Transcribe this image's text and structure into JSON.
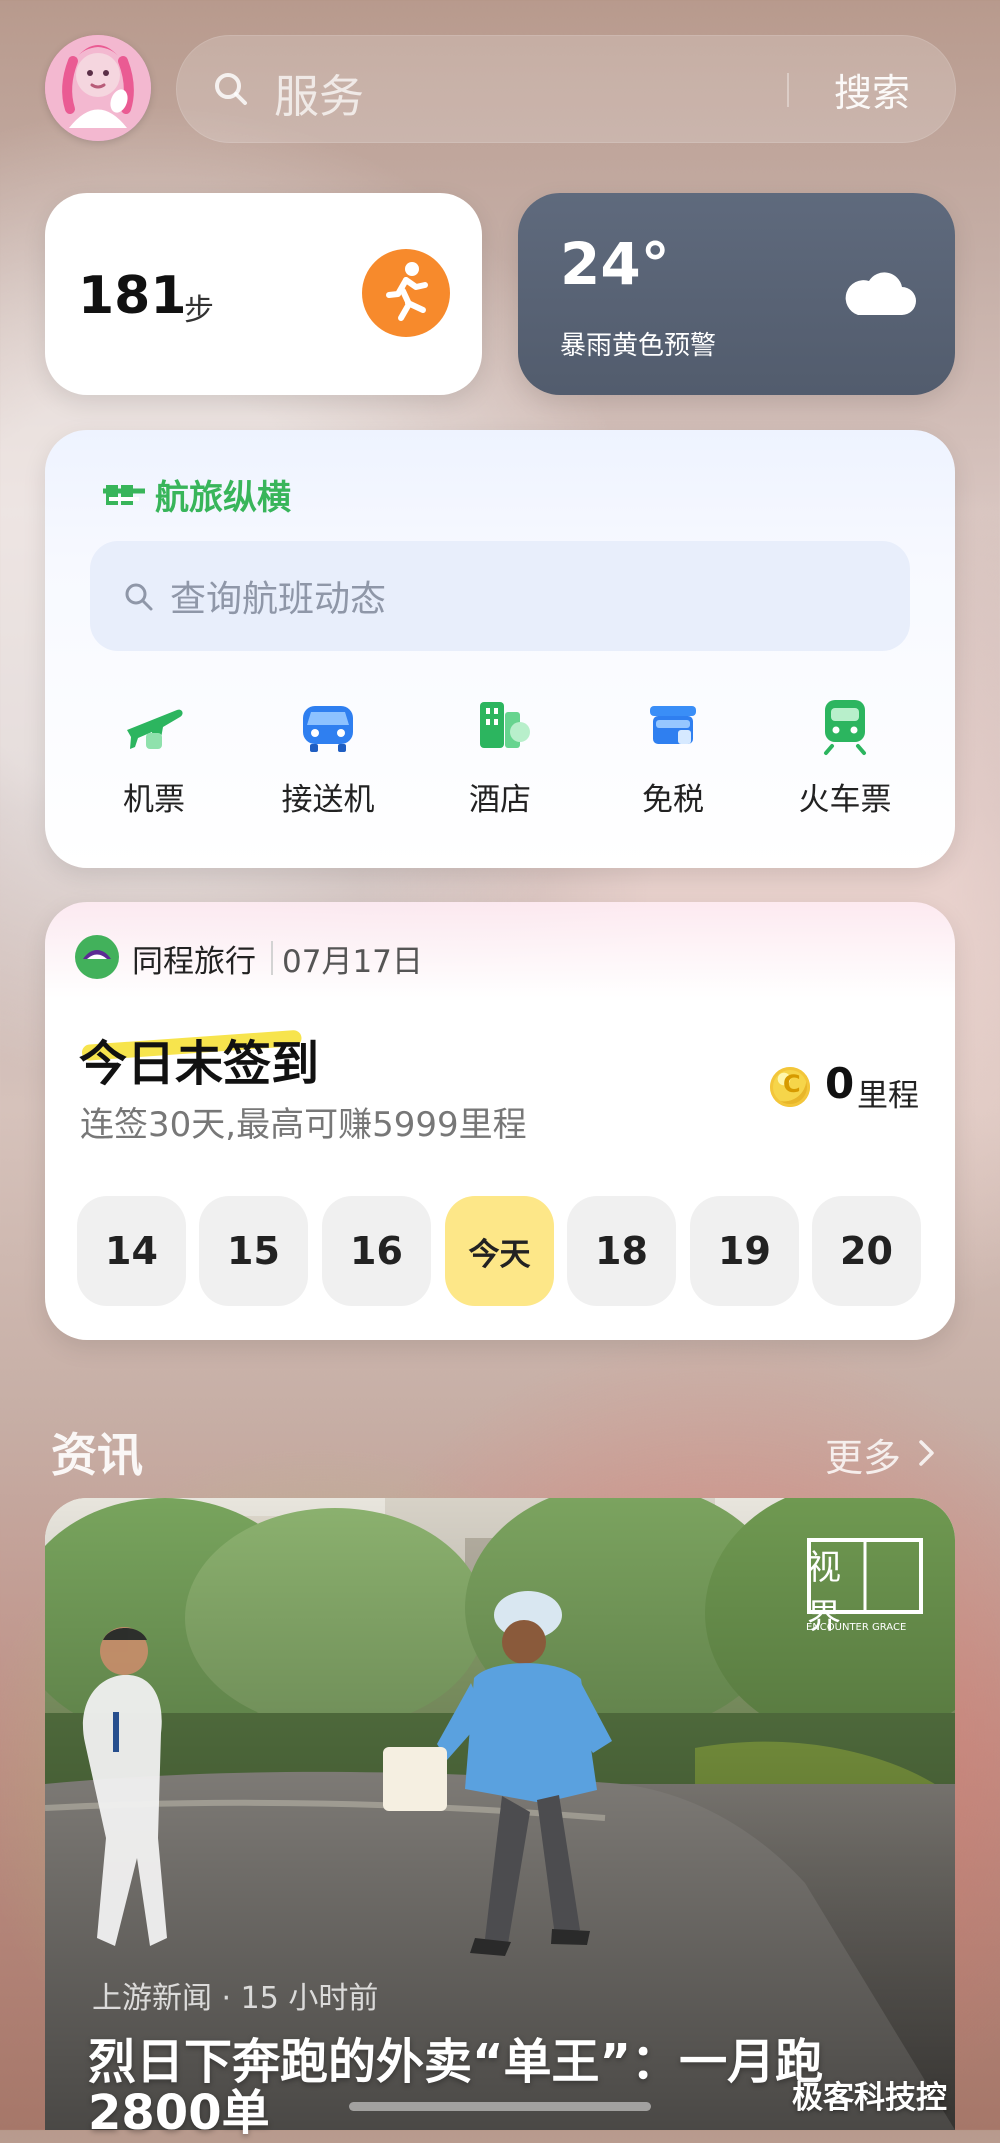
{
  "header": {
    "avatar_icon": "profile-avatar",
    "search_placeholder": "服务",
    "search_button": "搜索"
  },
  "steps_card": {
    "count": "181",
    "unit": "步",
    "icon": "running-person-icon",
    "accent_color": "#f78a2c"
  },
  "weather_card": {
    "temperature": "24°",
    "alert": "暴雨黄色预警",
    "icon": "cloud-icon",
    "background_color": "#5b6577"
  },
  "travel_card": {
    "brand": "航旅纵横",
    "brand_icon": "travel-brand-icon",
    "search_placeholder": "查询航班动态",
    "services": [
      {
        "label": "机票",
        "icon": "plane-ticket-icon"
      },
      {
        "label": "接送机",
        "icon": "car-icon"
      },
      {
        "label": "酒店",
        "icon": "hotel-icon"
      },
      {
        "label": "免税",
        "icon": "duty-free-shop-icon"
      },
      {
        "label": "火车票",
        "icon": "train-icon"
      }
    ],
    "accent_color": "#38b55a"
  },
  "checkin_card": {
    "brand": "同程旅行",
    "date": "07月17日",
    "title": "今日未签到",
    "subtitle": "连签30天,最高可赚5999里程",
    "coin_mark": "C",
    "mileage_value": "0",
    "mileage_unit": "里程",
    "days": [
      "14",
      "15",
      "16",
      "今天",
      "18",
      "19",
      "20"
    ],
    "highlight_color": "#f7e44d",
    "today_color": "#fde788"
  },
  "news_section": {
    "title": "资讯",
    "more": "更多",
    "more_icon": "chevron-right-icon"
  },
  "news_item": {
    "source": "上游新闻",
    "time": "15 小时前",
    "title_line_1": "烈日下奔跑的外卖“单王”：一月跑",
    "title_line_2": "2800单",
    "image_badge": "视界",
    "image_badge_subtitle": "ENCOUNTER GRACE",
    "watermark": "极客科技控"
  }
}
